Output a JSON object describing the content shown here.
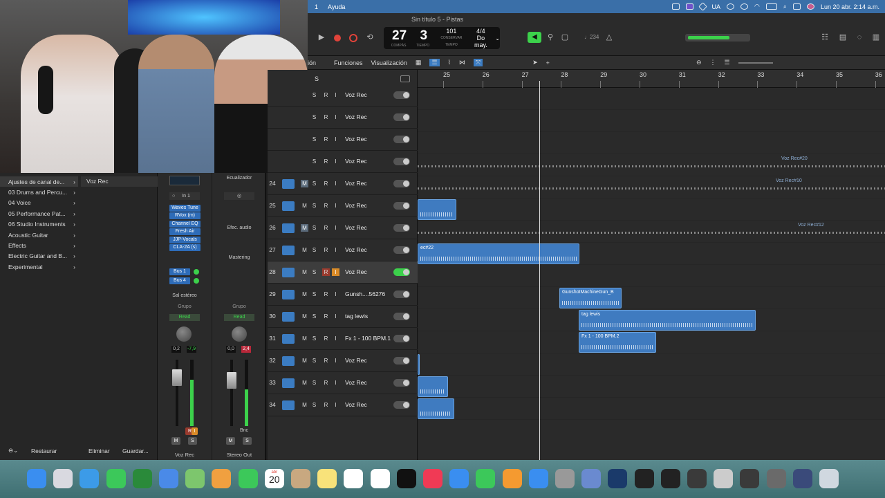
{
  "menubar": {
    "app_number": "1",
    "help": "Ayuda",
    "input_source": "UA",
    "datetime": "Lun 20 abr.  2:14 a.m."
  },
  "window": {
    "title": "Sin título 5 - Pistas"
  },
  "transport": {
    "bar": "27",
    "beat": "3",
    "bar_label": "COMPÁS",
    "beat_label": "TIEMPO",
    "tempo": "101",
    "tempo_label": "CONSERVAR",
    "tempo_sub": "TEMPO",
    "signature": "4/4",
    "key": "Do may.",
    "count_in": "♩234"
  },
  "subbar": {
    "edit": "ión",
    "functions": "Funciones",
    "view": "Visualización"
  },
  "library": {
    "items": [
      {
        "label": "Ajustes de canal de..."
      },
      {
        "label": "03 Drums and Percu..."
      },
      {
        "label": "04 Voice"
      },
      {
        "label": "05 Performance Pat..."
      },
      {
        "label": "06 Studio Instruments"
      },
      {
        "label": "Acoustic Guitar"
      },
      {
        "label": "Effects"
      },
      {
        "label": "Electric Guitar and B..."
      },
      {
        "label": "Experimental"
      }
    ],
    "selected_preset": "Voz Rec",
    "restore": "Restaurar",
    "delete": "Eliminar",
    "save": "Guardar..."
  },
  "mixer": {
    "strip1": {
      "input": "In 1",
      "plugins": [
        "Waves Tune",
        "RVox (m)",
        "Channel EQ",
        "Fresh Air",
        "JJP-Vocals",
        "CLA-2A (s)"
      ],
      "sends": [
        "Bus 1",
        "Bus 4"
      ],
      "output": "Sal estéreo",
      "group": "Grupo",
      "automation": "Read",
      "pan_value": "0,2",
      "peak_value": "-7,9",
      "name": "Voz Rec",
      "level": 0.7
    },
    "strip2": {
      "eq": "Ecualizador",
      "fx": "Efec. audio",
      "mastering": "Mastering",
      "group": "Grupo",
      "automation": "Read",
      "pan_value": "0,0",
      "peak_value": "2,4",
      "bounce": "Bnc",
      "name": "Stereo Out",
      "level": 0.55
    },
    "m": "M",
    "s": "S",
    "r": "R",
    "i": "I"
  },
  "tracks": [
    {
      "num": "",
      "name": "Voz Rec",
      "m": "",
      "s": "S",
      "r": "R",
      "i": "I"
    },
    {
      "num": "",
      "name": "Voz Rec",
      "m": "",
      "s": "S",
      "r": "R",
      "i": "I"
    },
    {
      "num": "",
      "name": "Voz Rec",
      "m": "",
      "s": "S",
      "r": "R",
      "i": "I"
    },
    {
      "num": "",
      "name": "Voz Rec",
      "m": "",
      "s": "S",
      "r": "R",
      "i": "I"
    },
    {
      "num": "24",
      "name": "Voz Rec",
      "m": "M",
      "s": "S",
      "r": "R",
      "i": "I"
    },
    {
      "num": "25",
      "name": "Voz Rec",
      "m": "M",
      "s": "S",
      "r": "R",
      "i": "I"
    },
    {
      "num": "26",
      "name": "Voz Rec",
      "m": "M",
      "s": "S",
      "r": "R",
      "i": "I"
    },
    {
      "num": "27",
      "name": "Voz Rec",
      "m": "M",
      "s": "S",
      "r": "R",
      "i": "I"
    },
    {
      "num": "28",
      "name": "Voz Rec",
      "m": "M",
      "s": "S",
      "r": "R",
      "i": "I"
    },
    {
      "num": "29",
      "name": "Gunsh....56276",
      "m": "M",
      "s": "S",
      "r": "R",
      "i": "I"
    },
    {
      "num": "30",
      "name": "tag lewis",
      "m": "M",
      "s": "S",
      "r": "R",
      "i": "I"
    },
    {
      "num": "31",
      "name": "Fx 1 - 100 BPM.1",
      "m": "M",
      "s": "S",
      "r": "R",
      "i": "I"
    },
    {
      "num": "32",
      "name": "Voz Rec",
      "m": "M",
      "s": "S",
      "r": "R",
      "i": "I"
    },
    {
      "num": "33",
      "name": "Voz Rec",
      "m": "M",
      "s": "S",
      "r": "R",
      "i": "I"
    },
    {
      "num": "34",
      "name": "Voz Rec",
      "m": "M",
      "s": "S",
      "r": "R",
      "i": "I"
    }
  ],
  "header_s": "S",
  "ruler": [
    "25",
    "26",
    "27",
    "28",
    "29",
    "30",
    "31",
    "32",
    "33",
    "34",
    "35",
    "36"
  ],
  "regions": {
    "r20": "Voz Rec#20",
    "r10": "Voz Rec#10",
    "r12": "Voz Rec#12",
    "r22": "ec#22",
    "gun": "GunshotMachineGun_B",
    "tag": "tag lewis",
    "fx": "Fx 1 - 100 BPM.2"
  },
  "dock_calendar": {
    "month": "abr",
    "day": "20"
  },
  "colors": {
    "accent": "#3b7cc2",
    "meter": "#3cd14b",
    "record": "#e0433a"
  }
}
